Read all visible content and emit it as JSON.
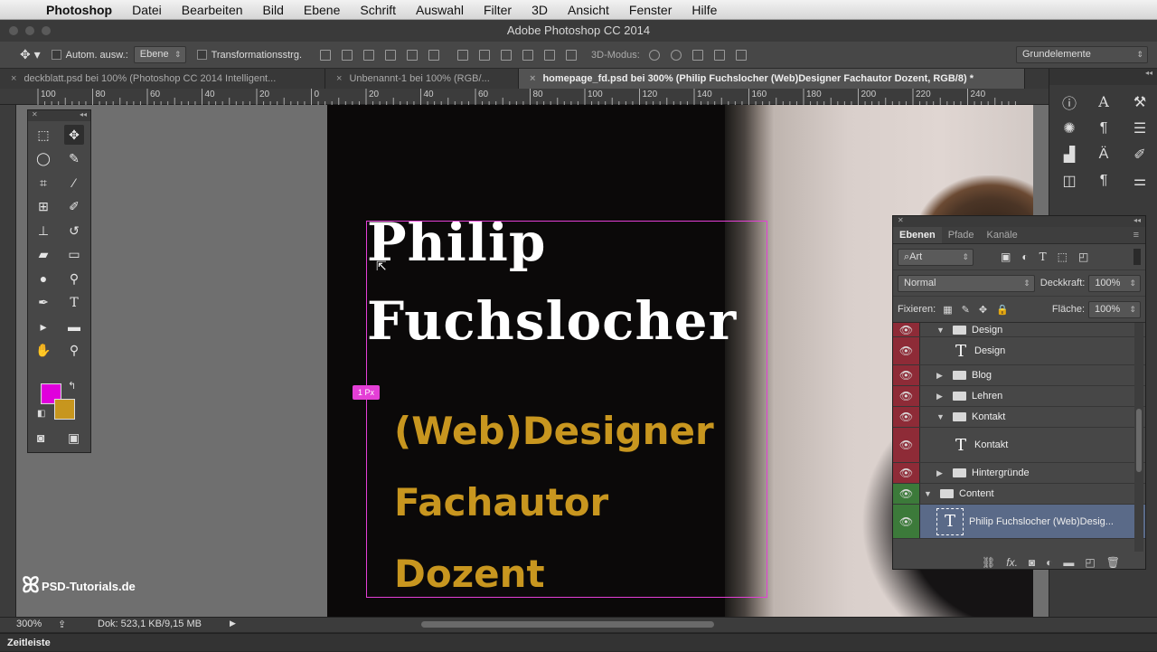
{
  "menubar": {
    "app": "Photoshop",
    "items": [
      "Datei",
      "Bearbeiten",
      "Bild",
      "Ebene",
      "Schrift",
      "Auswahl",
      "Filter",
      "3D",
      "Ansicht",
      "Fenster",
      "Hilfe"
    ]
  },
  "window": {
    "title": "Adobe Photoshop CC 2014"
  },
  "options": {
    "auto_select_label": "Autom. ausw.:",
    "auto_select_value": "Ebene",
    "transform_label": "Transformationsstrg.",
    "mode3d_label": "3D-Modus:",
    "workspace": "Grundelemente"
  },
  "tabs": [
    {
      "label": "deckblatt.psd bei 100% (Photoshop CC 2014  Intelligent..."
    },
    {
      "label": "Unbenannt-1 bei 100% (RGB/..."
    },
    {
      "label": "homepage_fd.psd bei 300% (Philip  Fuchslocher (Web)Designer Fachautor Dozent, RGB/8) *"
    }
  ],
  "ruler_top": [
    "100",
    "80",
    "60",
    "40",
    "20",
    "0",
    "20",
    "40",
    "60",
    "80",
    "100",
    "120",
    "140",
    "160",
    "180",
    "200",
    "220",
    "240"
  ],
  "canvas": {
    "first_name": "Philip",
    "last_name": "Fuchslocher",
    "lines": [
      "(Web)Designer",
      "Fachautor",
      "Dozent"
    ],
    "spacing_badge": "1 Px"
  },
  "colors": {
    "foreground": "#e000dc",
    "background": "#c7961e",
    "selection": "#e43fd6",
    "gold_text": "#c8961f"
  },
  "layers_panel": {
    "tabs": [
      "Ebenen",
      "Pfade",
      "Kanäle"
    ],
    "filter_label": "Art",
    "blend_mode": "Normal",
    "opacity_label": "Deckkraft:",
    "opacity_value": "100%",
    "lock_label": "Fixieren:",
    "fill_label": "Fläche:",
    "fill_value": "100%",
    "layers": [
      {
        "name": "Design",
        "kind": "group-open"
      },
      {
        "name": "Design",
        "kind": "text"
      },
      {
        "name": "Blog",
        "kind": "group"
      },
      {
        "name": "Lehren",
        "kind": "group"
      },
      {
        "name": "Kontakt",
        "kind": "group-open"
      },
      {
        "name": "Kontakt",
        "kind": "text"
      },
      {
        "name": "Hintergründe",
        "kind": "group"
      },
      {
        "name": "Content",
        "kind": "group-open"
      },
      {
        "name": "Philip  Fuchslocher (Web)Desig...",
        "kind": "text-selected"
      }
    ]
  },
  "status": {
    "zoom": "300%",
    "doc": "Dok: 523,1 KB/9,15 MB"
  },
  "timeline": {
    "label": "Zeitleiste"
  },
  "watermark": {
    "text": "PSD-Tutorials.de"
  }
}
